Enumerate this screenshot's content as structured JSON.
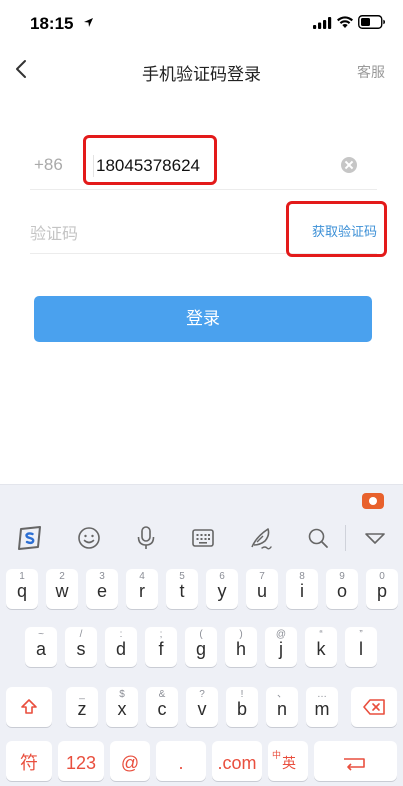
{
  "status_bar": {
    "time": "18:15"
  },
  "nav": {
    "title": "手机验证码登录",
    "service_label": "客服"
  },
  "phone": {
    "country_code": "+86",
    "value": "18045378624"
  },
  "code": {
    "placeholder": "验证码",
    "get_code_label": "获取验证码"
  },
  "login": {
    "label": "登录"
  },
  "keyboard": {
    "toolbar_icons": [
      "sogou-logo-icon",
      "emoji-icon",
      "microphone-icon",
      "keyboard-icon",
      "handwriting-icon",
      "search-icon",
      "collapse-icon"
    ],
    "row1": [
      {
        "hint": "1",
        "key": "q"
      },
      {
        "hint": "2",
        "key": "w"
      },
      {
        "hint": "3",
        "key": "e"
      },
      {
        "hint": "4",
        "key": "r"
      },
      {
        "hint": "5",
        "key": "t"
      },
      {
        "hint": "6",
        "key": "y"
      },
      {
        "hint": "7",
        "key": "u"
      },
      {
        "hint": "8",
        "key": "i"
      },
      {
        "hint": "9",
        "key": "o"
      },
      {
        "hint": "0",
        "key": "p"
      }
    ],
    "row2": [
      {
        "hint": "~",
        "key": "a"
      },
      {
        "hint": "/",
        "key": "s"
      },
      {
        "hint": ":",
        "key": "d"
      },
      {
        "hint": ";",
        "key": "f"
      },
      {
        "hint": "(",
        "key": "g"
      },
      {
        "hint": ")",
        "key": "h"
      },
      {
        "hint": "@",
        "key": "j"
      },
      {
        "hint": "“",
        "key": "k"
      },
      {
        "hint": "”",
        "key": "l"
      }
    ],
    "row3": [
      {
        "hint": "_",
        "key": "z"
      },
      {
        "hint": "$",
        "key": "x"
      },
      {
        "hint": "&",
        "key": "c"
      },
      {
        "hint": "?",
        "key": "v"
      },
      {
        "hint": "!",
        "key": "b"
      },
      {
        "hint": "、",
        "key": "n"
      },
      {
        "hint": "…",
        "key": "m"
      }
    ],
    "row4": {
      "symbol": "符",
      "numbers": "123",
      "at": "@",
      "dot": ".",
      "com": ".com",
      "lang_small": "中",
      "lang_main": "英"
    },
    "colors": {
      "accent_red": "#e94f3e",
      "button_blue": "#4aa1ee",
      "link_blue": "#3b8fd6"
    }
  }
}
